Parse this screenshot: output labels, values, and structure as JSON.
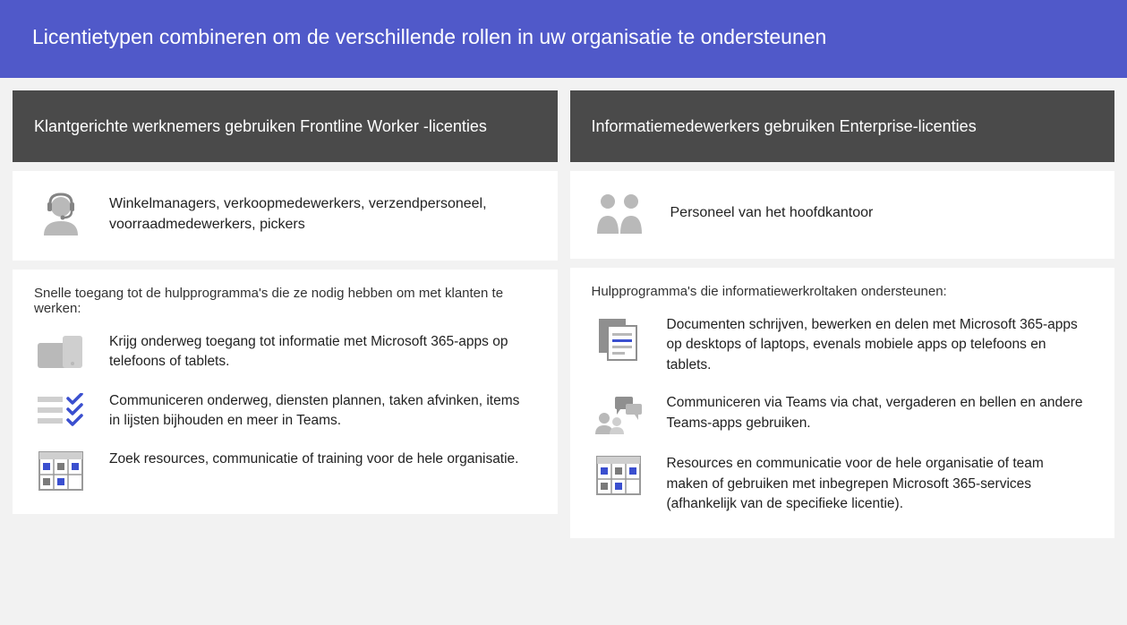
{
  "banner": {
    "title": "Licentietypen combineren om de verschillende rollen in uw organisatie te ondersteunen"
  },
  "columns": {
    "left": {
      "header": "Klantgerichte werknemers gebruiken Frontline Worker -licenties",
      "persona": "Winkelmanagers, verkoopmedewerkers, verzendpersoneel, voorraadmedewerkers, pickers",
      "tools_intro": "Snelle toegang tot de hulpprogramma's die ze nodig hebben om met klanten te werken:",
      "items": [
        "Krijg onderweg toegang tot informatie met Microsoft 365-apps op telefoons of tablets.",
        "Communiceren onderweg, diensten plannen, taken afvinken, items in lijsten bijhouden en meer in Teams.",
        "Zoek resources, communicatie of training voor de hele organisatie."
      ]
    },
    "right": {
      "header": "Informatiemedewerkers gebruiken Enterprise-licenties",
      "persona": "Personeel van het hoofdkantoor",
      "tools_intro": "Hulpprogramma's die informatiewerkroltaken ondersteunen:",
      "items": [
        "Documenten schrijven, bewerken en delen met Microsoft 365-apps op desktops of laptops, evenals mobiele apps op telefoons en tablets.",
        "Communiceren via Teams via chat, vergaderen en bellen en andere Teams-apps gebruiken.",
        "Resources en communicatie voor de hele organisatie of team maken of gebruiken met inbegrepen Microsoft 365-services (afhankelijk van de specifieke licentie)."
      ]
    }
  },
  "colors": {
    "banner_bg": "#5059c9",
    "header_bg": "#4a4a4a",
    "icon_gray": "#b9b9b9",
    "icon_accent": "#3a4fcf"
  }
}
